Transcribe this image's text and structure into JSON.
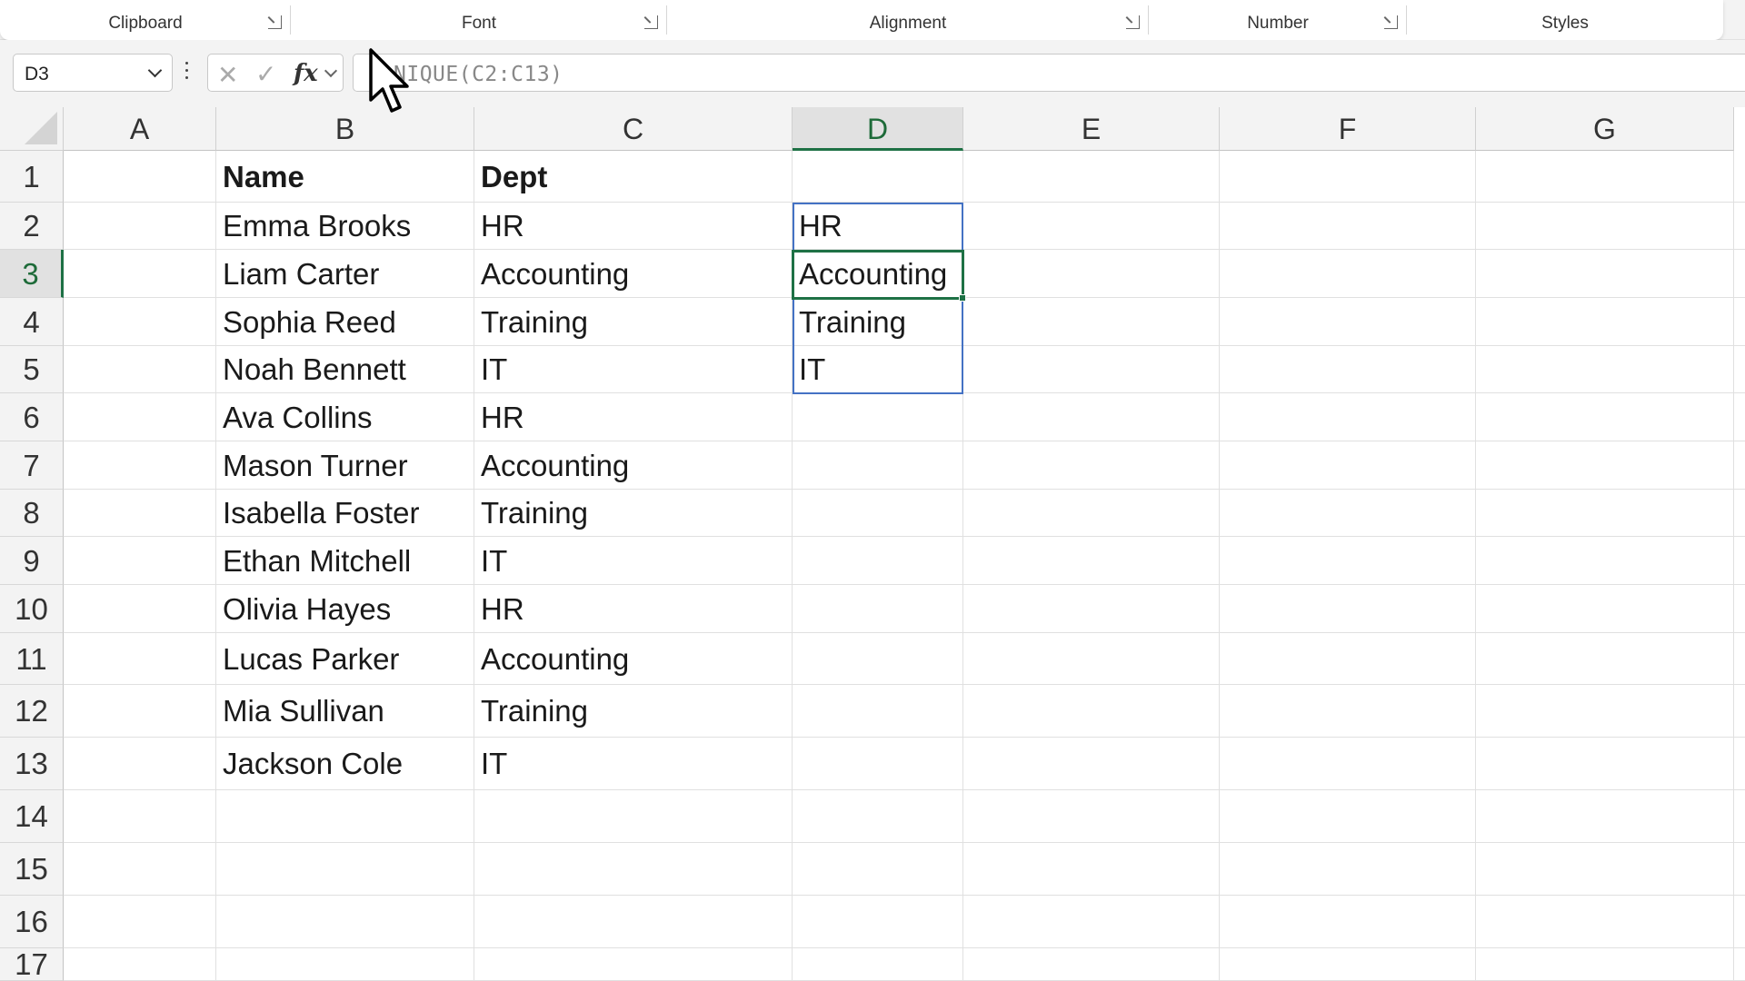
{
  "ribbon": {
    "groups": [
      {
        "label": "Clipboard",
        "launcher": true
      },
      {
        "label": "Font",
        "launcher": true
      },
      {
        "label": "Alignment",
        "launcher": true
      },
      {
        "label": "Number",
        "launcher": true
      },
      {
        "label": "Styles",
        "launcher": false
      }
    ]
  },
  "formula_bar": {
    "name_box": "D3",
    "formula": "=UNIQUE(C2:C13)",
    "formula_visible": "NIQUE(C2:C13)",
    "cancel_icon": "x-icon",
    "enter_icon": "check-icon",
    "insert_function_icon": "fx-icon"
  },
  "sheet": {
    "columns": [
      "A",
      "B",
      "C",
      "D",
      "E",
      "F",
      "G"
    ],
    "active_column": "D",
    "rows": [
      "1",
      "2",
      "3",
      "4",
      "5",
      "6",
      "7",
      "8",
      "9",
      "10",
      "11",
      "12",
      "13",
      "14",
      "15",
      "16",
      "17"
    ],
    "active_row": "3",
    "headers": {
      "name": "Name",
      "dept": "Dept"
    },
    "data": [
      {
        "name": "Emma Brooks",
        "dept": "HR"
      },
      {
        "name": "Liam Carter",
        "dept": "Accounting"
      },
      {
        "name": "Sophia Reed",
        "dept": "Training"
      },
      {
        "name": "Noah Bennett",
        "dept": "IT"
      },
      {
        "name": "Ava Collins",
        "dept": "HR"
      },
      {
        "name": "Mason Turner",
        "dept": "Accounting"
      },
      {
        "name": "Isabella Foster",
        "dept": "Training"
      },
      {
        "name": "Ethan Mitchell",
        "dept": "IT"
      },
      {
        "name": "Olivia Hayes",
        "dept": "HR"
      },
      {
        "name": "Lucas Parker",
        "dept": "Accounting"
      },
      {
        "name": "Mia Sullivan",
        "dept": "Training"
      },
      {
        "name": "Jackson Cole",
        "dept": "IT"
      }
    ],
    "unique_result": [
      "HR",
      "Accounting",
      "Training",
      "IT"
    ]
  },
  "colors": {
    "accent_green": "#1e7145",
    "spill_blue": "#4472c4",
    "header_bg": "#f3f3f3"
  }
}
